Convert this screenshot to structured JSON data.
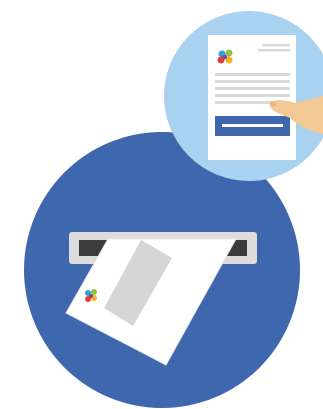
{
  "illustration": {
    "theme": "mail-slot-and-document",
    "palette": {
      "background": "#ffffff",
      "main_circle": "#3f67ae",
      "slot_frame": "#dcdcdc",
      "slot_opening": "#3b3b3b",
      "paper": "#ffffff",
      "paper_window": "#d6d6d6",
      "badge_circle": "#a9d1f0",
      "document_lines": "#d9d9d9",
      "document_button": "#3f67ae",
      "hand": "#f2c994",
      "logo_colors": [
        "#e23b3b",
        "#2f9fd8",
        "#8bc34a",
        "#f0b323",
        "#7b3fa0"
      ]
    },
    "icons": [
      "main-circle",
      "mail-slot-icon",
      "envelope-icon",
      "logo-icon",
      "zoom-badge",
      "document-icon",
      "hand-pointer-icon"
    ]
  }
}
